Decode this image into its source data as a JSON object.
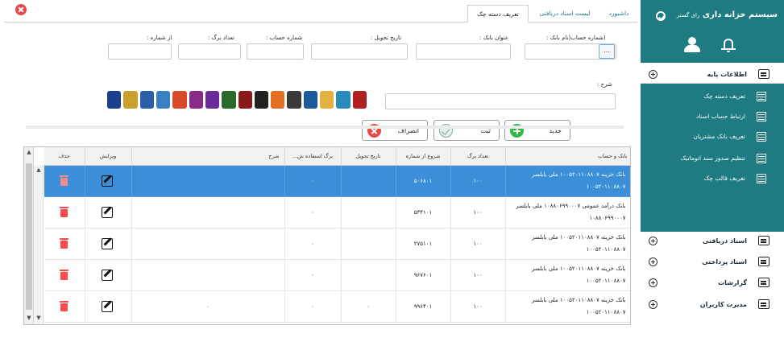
{
  "sidebar": {
    "title": "سیستم خزانه داری",
    "brand": "رای گستر",
    "sections": [
      {
        "label": "اطلاعات پایه"
      },
      {
        "label": "اسناد دریافتی"
      },
      {
        "label": "اسناد پرداختی"
      },
      {
        "label": "گزارشات"
      },
      {
        "label": "مدیرت کاربران"
      }
    ],
    "sub_items": [
      {
        "label": "تعریف دسته چک"
      },
      {
        "label": "ارتباط حساب اسناد"
      },
      {
        "label": "تعریف بانک مشتریان"
      },
      {
        "label": "تنظیم صدور سند اتوماتیک"
      },
      {
        "label": "تعریف قالب چک"
      }
    ]
  },
  "tabs": [
    {
      "label": "داشبورد"
    },
    {
      "label": "لیست اسناد دریافتی"
    },
    {
      "label": "تعریف دسته چک"
    }
  ],
  "form": {
    "account_label": "(شماره حساب(نام بانک :",
    "branch_label": "عنوان بانک :",
    "delivery_date_label": "تاریخ تحویل :",
    "account_no_label": "شماره حساب :",
    "sheet_count_label": "تعداد برگ :",
    "from_no_label": "از شماره :",
    "desc_label": "شرح :",
    "lookup_button": "..."
  },
  "actions": {
    "new": "جدید",
    "save": "ثبت",
    "cancel": "انصراف"
  },
  "grid": {
    "headers": {
      "bank": "بانک و حساب",
      "count": "تعداد برگ",
      "start": "شروع از شماره",
      "delivery": "تاریخ تحویل",
      "used": "برگ استفاده ش...",
      "desc": "شرح",
      "edit": "ویرایش",
      "delete": "حذف"
    },
    "rows": [
      {
        "bank1": "بانک خزینه ۱۰۰۵۲۰۱۱۰۸۸۰۷ ملی بابلسر",
        "bank2": "۱۰۰۵۲۰۱۱۰۸۸۰۷",
        "count": "۱۰۰",
        "start": "۵۰۶۸۰۱",
        "delivery": "",
        "used": "۰",
        "desc": ""
      },
      {
        "bank1": "بانک درآمد عمومی ۱۰۸۸۰۶۹۹۰۰۰۷ ملی بابلسر",
        "bank2": "۱۰۸۸۰۶۹۹۰۰۰۷",
        "count": "۱۰۰",
        "start": "۵۳۴۱۰۱",
        "delivery": "",
        "used": "۰",
        "desc": ""
      },
      {
        "bank1": "بانک خزینه ۱۰۰۵۲۰۱۱۰۸۸۰۷ ملی بابلسر",
        "bank2": "۱۰۰۵۲۰۱۱۰۸۸۰۷",
        "count": "۱۰۰",
        "start": "۲۷۵۱۰۱",
        "delivery": "",
        "used": "۰",
        "desc": ""
      },
      {
        "bank1": "بانک خزینه ۱۰۰۵۲۰۱۱۰۸۸۰۷ ملی بابلسر",
        "bank2": "۱۰۰۵۲۰۱۱۰۸۸۰۷",
        "count": "۱۰۰",
        "start": "۹۶۷۶۰۱",
        "delivery": "",
        "used": "۰",
        "desc": ""
      },
      {
        "bank1": "بانک خزینه ۱۰۰۵۲۰۱۱۰۸۸۰۷ ملی بابلسر",
        "bank2": "۱۰۰۵۲۰۱۱۰۸۸۰۷",
        "count": "۱۰۰",
        "start": "۹۹۶۴۰۱",
        "delivery": "۰",
        "used": "۰",
        "desc": "۰"
      }
    ]
  },
  "colors": {
    "teal": "#1e7b82",
    "selected_row": "#3a8fd8",
    "add_green": "#2fb84a",
    "cancel_red": "#e64848"
  }
}
